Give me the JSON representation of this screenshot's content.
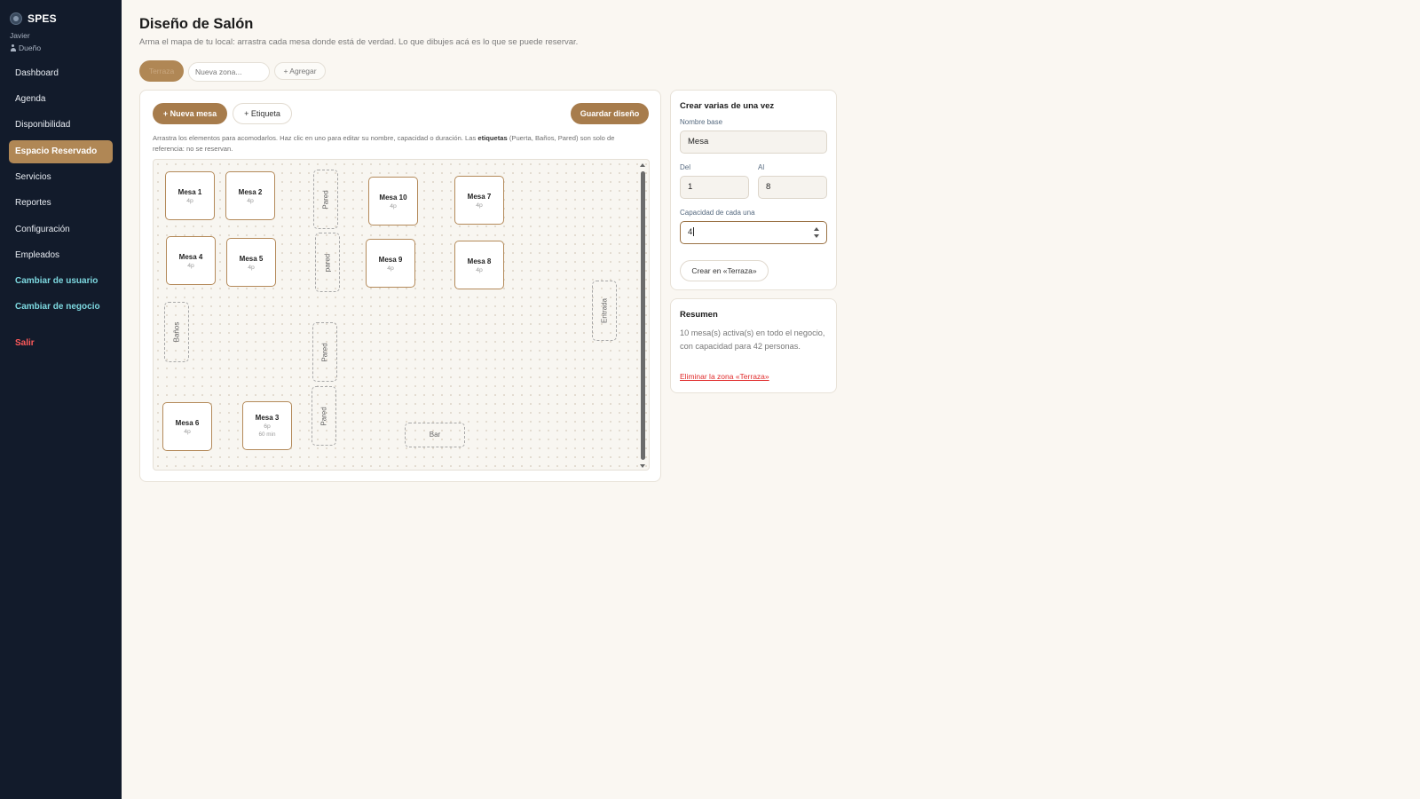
{
  "sidebar": {
    "brand": "SPES",
    "user_name": "Javier",
    "user_role": "Dueño",
    "items": [
      {
        "label": "Dashboard"
      },
      {
        "label": "Agenda"
      },
      {
        "label": "Disponibilidad"
      },
      {
        "label": "Espacio Reservado",
        "active": true
      },
      {
        "label": "Servicios"
      },
      {
        "label": "Reportes"
      },
      {
        "label": "Configuración"
      },
      {
        "label": "Empleados"
      },
      {
        "label": "Cambiar de usuario"
      },
      {
        "label": "Cambiar de negocio"
      },
      {
        "label": "Salir"
      }
    ]
  },
  "header": {
    "title": "Diseño de Salón",
    "subtitle": "Arma el mapa de tu local: arrastra cada mesa donde está de verdad. Lo que dibujes acá es lo que se puede reservar."
  },
  "zones": {
    "active_tab": "Terraza",
    "new_zone_placeholder": "Nueva zona...",
    "add_label": "+ Agregar"
  },
  "editor": {
    "new_table_label": "+ Nueva mesa",
    "new_label_label": "+ Etiqueta",
    "save_label": "Guardar diseño",
    "help_pre": "Arrastra los elementos para acomodarlos. Haz clic en uno para editar su nombre, capacidad o duración. Las ",
    "help_bold": "etiquetas",
    "help_post": " (Puerta, Baños, Pared) son solo de referencia: no se reservan.",
    "tables": [
      {
        "name": "Mesa 1",
        "capacity": "4p"
      },
      {
        "name": "Mesa 2",
        "capacity": "4p"
      },
      {
        "name": "Mesa 10",
        "capacity": "4p"
      },
      {
        "name": "Mesa 7",
        "capacity": "4p"
      },
      {
        "name": "Mesa 4",
        "capacity": "4p"
      },
      {
        "name": "Mesa 5",
        "capacity": "4p"
      },
      {
        "name": "Mesa 9",
        "capacity": "4p"
      },
      {
        "name": "Mesa 8",
        "capacity": "4p"
      },
      {
        "name": "Mesa 6",
        "capacity": "4p"
      },
      {
        "name": "Mesa 3",
        "capacity": "6p",
        "duration": "60 min"
      }
    ],
    "labels": [
      {
        "text": "Pared"
      },
      {
        "text": "pared"
      },
      {
        "text": "Pared"
      },
      {
        "text": "Pared"
      },
      {
        "text": "Baños"
      },
      {
        "text": "Entrada"
      },
      {
        "text": "Bar"
      }
    ]
  },
  "create": {
    "title": "Crear varias de una vez",
    "base_name_label": "Nombre base",
    "base_name_value": "Mesa",
    "from_label": "Del",
    "from_value": "1",
    "to_label": "Al",
    "to_value": "8",
    "capacity_label": "Capacidad de cada una",
    "capacity_value": "4",
    "create_button": "Crear en «Terraza»"
  },
  "summary": {
    "title": "Resumen",
    "text": "10 mesa(s) activa(s) en todo el negocio, con capacidad para 42 personas.",
    "delete_link": "Eliminar la zona «Terraza»"
  }
}
